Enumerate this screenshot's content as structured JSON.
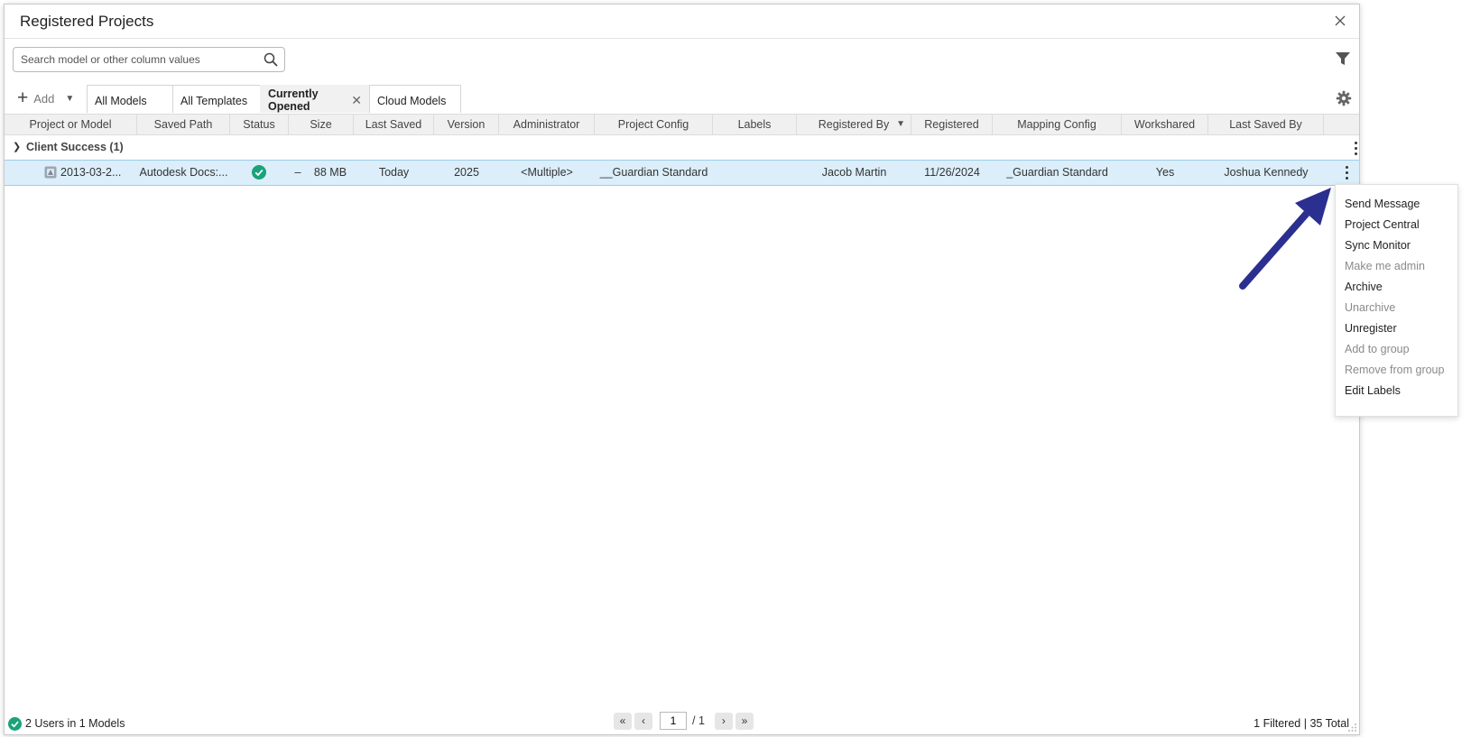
{
  "window": {
    "title": "Registered Projects"
  },
  "search": {
    "placeholder": "Search model or other column values"
  },
  "toolbar": {
    "add_label": "Add"
  },
  "tabs": [
    {
      "label": "All Models"
    },
    {
      "label": "All Templates"
    },
    {
      "label": "Currently Opened",
      "active": true
    },
    {
      "label": "Cloud Models"
    }
  ],
  "columns": [
    "Project or Model",
    "Saved Path",
    "Status",
    "Size",
    "Last Saved",
    "Version",
    "Administrator",
    "Project Config",
    "Labels",
    "Registered By",
    "Registered",
    "Mapping Config",
    "Workshared",
    "Last Saved By"
  ],
  "group": {
    "label": "Client Success (1)"
  },
  "row": {
    "project": "2013-03-2...",
    "saved_path": "Autodesk Docs:...",
    "status": "ok",
    "size_dash": "–",
    "size": "88 MB",
    "last_saved": "Today",
    "version": "2025",
    "administrator": "<Multiple>",
    "project_config": "__Guardian Standard",
    "labels": "",
    "registered_by": "Jacob Martin",
    "registered": "11/26/2024",
    "mapping_config": "_Guardian Standard",
    "workshared": "Yes",
    "last_saved_by": "Joshua Kennedy"
  },
  "context_menu": [
    {
      "label": "Send Message",
      "enabled": true
    },
    {
      "label": "Project Central",
      "enabled": true
    },
    {
      "label": "Sync Monitor",
      "enabled": true
    },
    {
      "label": "Make me admin",
      "enabled": false
    },
    {
      "label": "Archive",
      "enabled": true
    },
    {
      "label": "Unarchive",
      "enabled": false
    },
    {
      "label": "Unregister",
      "enabled": true
    },
    {
      "label": "Add to group",
      "enabled": false
    },
    {
      "label": "Remove from group",
      "enabled": false
    },
    {
      "label": "Edit Labels",
      "enabled": true
    }
  ],
  "footer": {
    "users_status": "2 Users in 1 Models",
    "page_current": "1",
    "page_total": "/ 1",
    "counts": "1 Filtered | 35 Total"
  },
  "colors": {
    "accent_green": "#1aa37a",
    "row_selected": "#dbeefa",
    "arrow": "#2b2f8f"
  },
  "icons": [
    "close-icon",
    "search-icon",
    "filter-icon",
    "plus-icon",
    "gear-icon",
    "chevron-down-icon",
    "more-vertical-icon",
    "revit-model-icon",
    "check-circle-icon",
    "first-page-icon",
    "prev-page-icon",
    "next-page-icon",
    "last-page-icon"
  ]
}
